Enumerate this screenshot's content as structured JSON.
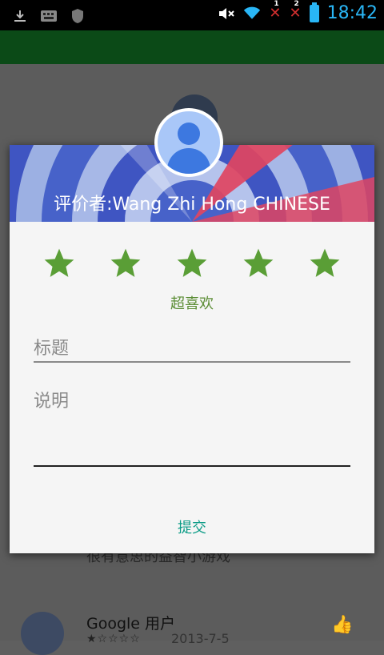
{
  "status_bar": {
    "time": "18:42",
    "x_badges": [
      "1",
      "2"
    ]
  },
  "dialog": {
    "reviewer": "评价者:Wang Zhi Hong  CHINESE",
    "rating": 5,
    "rating_max": 5,
    "rating_label": "超喜欢",
    "title_placeholder": "标题",
    "description_placeholder": "说明",
    "submit_label": "提交"
  },
  "background": {
    "partial_text": "很有意思的益智小游戏",
    "review": {
      "author": "Google 用户",
      "date": "2013-7-5"
    }
  },
  "colors": {
    "accent_green": "#5a8c33",
    "submit_teal": "#0f9d88",
    "clock_blue": "#29b6f6",
    "banner_blue": "#3d5bc4"
  }
}
